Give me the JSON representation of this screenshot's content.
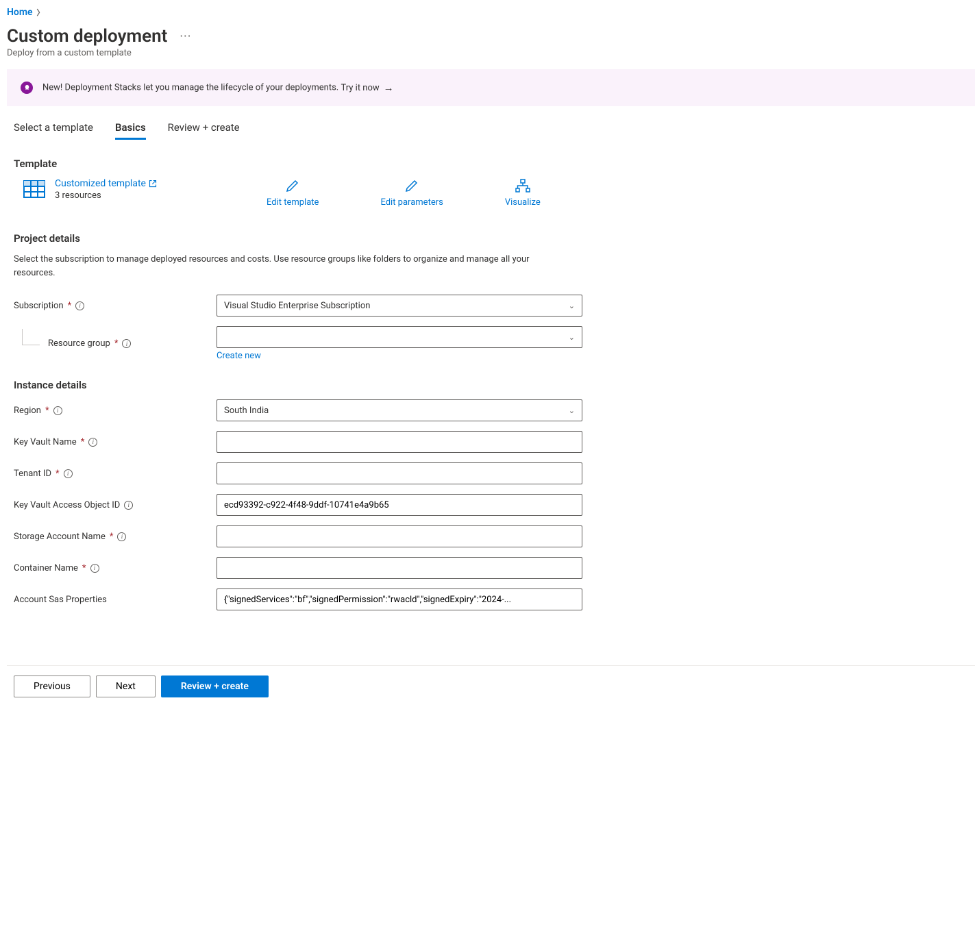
{
  "breadcrumb": {
    "home": "Home"
  },
  "header": {
    "title": "Custom deployment",
    "subtitle": "Deploy from a custom template"
  },
  "banner": {
    "text": "New! Deployment Stacks let you manage the lifecycle of your deployments.",
    "link_text": "Try it now"
  },
  "tabs": {
    "select_template": "Select a template",
    "basics": "Basics",
    "review_create": "Review + create"
  },
  "template_section": {
    "heading": "Template",
    "link": "Customized template",
    "resources": "3 resources",
    "actions": {
      "edit_template": "Edit template",
      "edit_parameters": "Edit parameters",
      "visualize": "Visualize"
    }
  },
  "project_section": {
    "heading": "Project details",
    "description": "Select the subscription to manage deployed resources and costs. Use resource groups like folders to organize and manage all your resources.",
    "subscription_label": "Subscription",
    "subscription_value": "Visual Studio Enterprise Subscription",
    "resource_group_label": "Resource group",
    "resource_group_value": "",
    "create_new": "Create new"
  },
  "instance_section": {
    "heading": "Instance details",
    "region_label": "Region",
    "region_value": "South India",
    "kv_name_label": "Key Vault Name",
    "kv_name_value": "",
    "tenant_label": "Tenant ID",
    "tenant_value": "",
    "kv_access_label": "Key Vault Access Object ID",
    "kv_access_value": "ecd93392-c922-4f48-9ddf-10741e4a9b65",
    "storage_label": "Storage Account Name",
    "storage_value": "",
    "container_label": "Container Name",
    "container_value": "",
    "sas_label": "Account Sas Properties",
    "sas_value": "{\"signedServices\":\"bf\",\"signedPermission\":\"rwacld\",\"signedExpiry\":\"2024-..."
  },
  "footer": {
    "previous": "Previous",
    "next": "Next",
    "review_create": "Review + create"
  }
}
